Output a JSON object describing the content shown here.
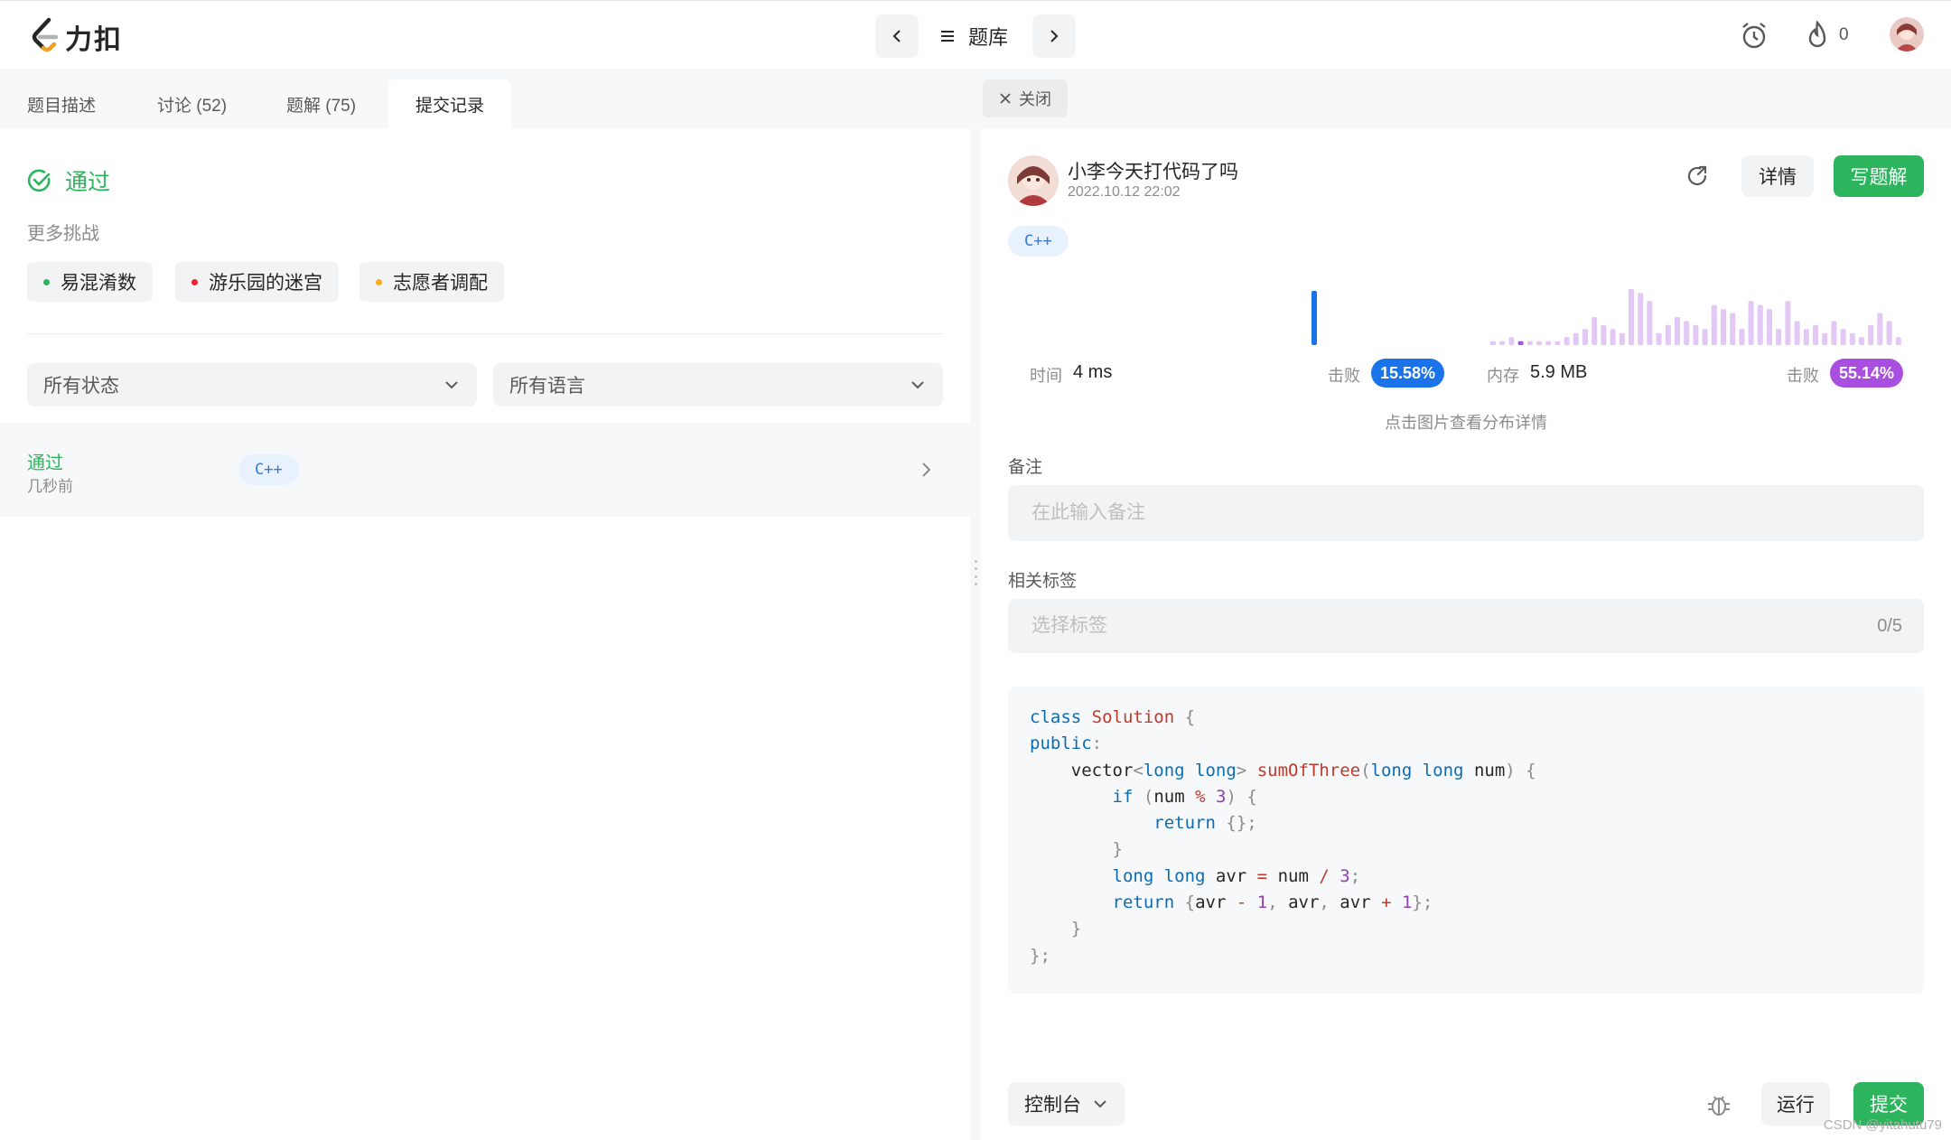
{
  "app": {
    "logo_text": "力扣"
  },
  "topbar": {
    "problem_bank_label": "题库",
    "streak_count": "0"
  },
  "left_tabs": [
    {
      "label": "题目描述"
    },
    {
      "label": "讨论 (52)"
    },
    {
      "label": "题解 (75)"
    },
    {
      "label": "提交记录"
    }
  ],
  "result": {
    "status": "通过",
    "more_challenges_title": "更多挑战",
    "challenges": [
      {
        "label": "易混淆数",
        "dot_color": "#2db55d"
      },
      {
        "label": "游乐园的迷宫",
        "dot_color": "#f5222d"
      },
      {
        "label": "志愿者调配",
        "dot_color": "#faad14"
      }
    ]
  },
  "filters": {
    "status_select": "所有状态",
    "language_select": "所有语言"
  },
  "submissions": [
    {
      "status": "通过",
      "time": "几秒前",
      "language": "C++"
    }
  ],
  "right_tabs": {
    "close_label": "关闭"
  },
  "detail": {
    "username": "小李今天打代码了吗",
    "date": "2022.10.12 22:02",
    "detail_button": "详情",
    "write_solution_button": "写题解",
    "language": "C++",
    "time_label": "时间",
    "time_value": "4 ms",
    "time_beat_label": "击败",
    "time_beat_value": "15.58%",
    "memory_label": "内存",
    "memory_value": "5.9 MB",
    "memory_beat_label": "击败",
    "memory_beat_value": "55.14%",
    "distribution_hint": "点击图片查看分布详情",
    "note_label": "备注",
    "note_placeholder": "在此输入备注",
    "tags_label": "相关标签",
    "tags_placeholder": "选择标签",
    "tags_count": "0/5"
  },
  "colors": {
    "accent_green": "#2db55d",
    "time_badge": "#1a73e8",
    "memory_badge": "#a94fe0",
    "time_bar": "#1a73e8",
    "memory_bar": "#e3c7f5"
  },
  "chart_data": {
    "type": "bar",
    "memory_distribution": [
      1,
      1,
      2,
      1,
      1,
      1,
      1,
      1,
      2,
      3,
      4,
      7,
      5,
      4,
      3,
      14,
      13,
      11,
      3,
      5,
      7,
      6,
      5,
      4,
      10,
      9,
      8,
      4,
      11,
      10,
      9,
      4,
      11,
      6,
      4,
      5,
      3,
      6,
      4,
      3,
      2,
      5,
      8,
      6,
      2
    ],
    "memory_highlight_index": 3,
    "time_bar_value": 1
  },
  "footer": {
    "console_label": "控制台",
    "run_label": "运行",
    "submit_label": "提交",
    "watermark": "CSDN @yitahutu79"
  }
}
